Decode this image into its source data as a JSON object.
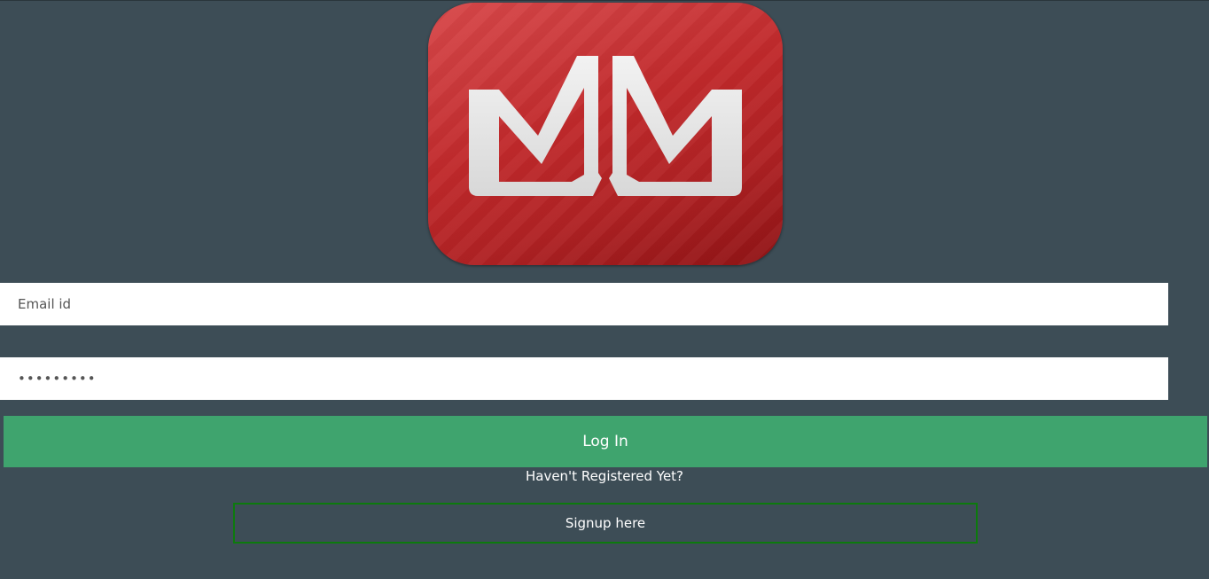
{
  "logo": {
    "icon": "mm-crown-logo-icon"
  },
  "form": {
    "email_placeholder": "Email id",
    "password_value": "•••••••••",
    "login_label": "Log In",
    "register_prompt": "Haven't Registered Yet?",
    "signup_label": "Signup here"
  },
  "colors": {
    "background": "#3d4d56",
    "logo_red": "#c0292b",
    "login_button": "#3fa46e",
    "signup_border": "#0d7a0d"
  }
}
